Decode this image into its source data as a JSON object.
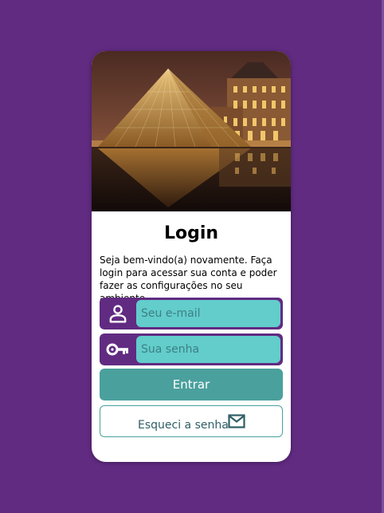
{
  "login": {
    "title": "Login",
    "welcome_text": "Seja bem-vindo(a) novamente. Faça login para acessar sua conta e poder fazer as configurações no seu ambiente.",
    "email": {
      "placeholder": "Seu e-mail",
      "value": "",
      "icon": "user-icon"
    },
    "password": {
      "placeholder": "Sua senha",
      "value": "",
      "icon": "key-icon"
    },
    "submit_label": "Entrar",
    "forgot_label": "Esqueci a senha",
    "forgot_icon": "mail-icon"
  },
  "colors": {
    "background": "#612b82",
    "input_fill": "#62cdcb",
    "button": "#4aa09d",
    "card": "#ffffff"
  }
}
